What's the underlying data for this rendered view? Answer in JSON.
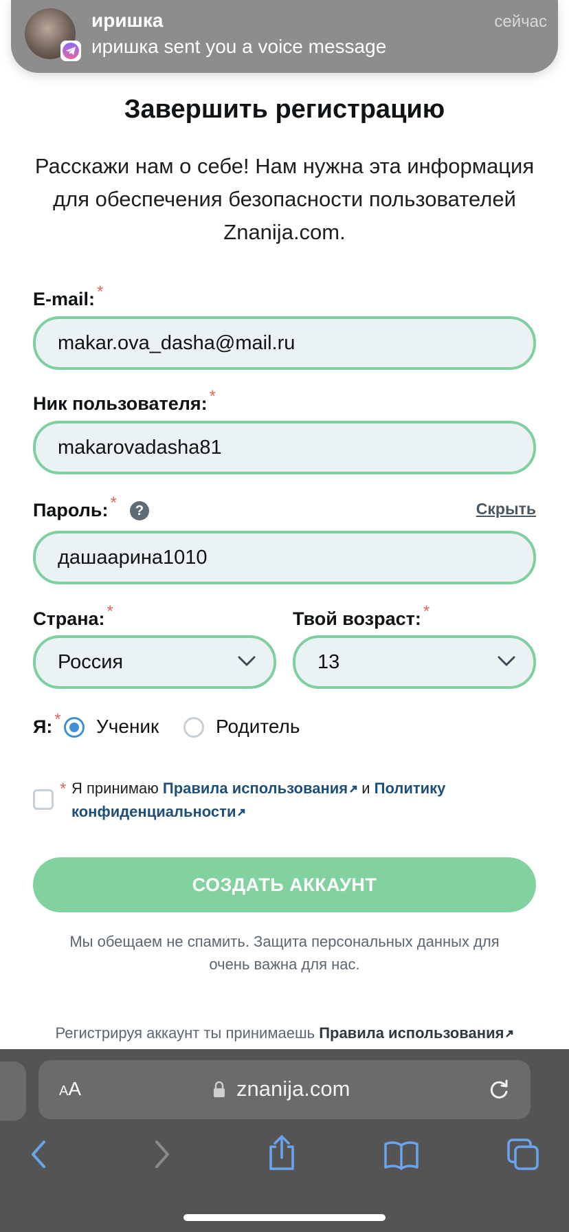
{
  "notification": {
    "sender": "иришка",
    "message": "иришка sent you a voice message",
    "time": "сейчас",
    "app_icon": "telegram-icon"
  },
  "form": {
    "title": "Завершить регистрацию",
    "subtitle": "Расскажи нам о себе! Нам нужна эта информация для обеспечения безопасности пользователей Znanija.com.",
    "required_mark": "*",
    "email": {
      "label": "E-mail:",
      "value": "makar.ova_dasha@mail.ru"
    },
    "nickname": {
      "label": "Ник пользователя:",
      "value": "makarovadasha81"
    },
    "password": {
      "label": "Пароль:",
      "value": "дашаарина1010",
      "help": "?",
      "toggle_label": "Скрыть"
    },
    "country": {
      "label": "Страна:",
      "value": "Россия"
    },
    "age": {
      "label": "Твой возраст:",
      "value": "13"
    },
    "role": {
      "label": "Я:",
      "options": [
        {
          "label": "Ученик",
          "selected": true
        },
        {
          "label": "Родитель",
          "selected": false
        }
      ]
    },
    "terms": {
      "checked": false,
      "prefix": "Я принимаю",
      "rules_link": "Правила использования",
      "and": "и",
      "policy_link": "Политику конфиденциальности"
    },
    "submit_label": "СОЗДАТЬ АККАУНТ",
    "promise": "Мы обещаем не спамить. Защита персональных данных для очень важна для нас.",
    "footer_prefix": "Регистрируя аккаунт ты принимаешь",
    "footer_link": "Правила использования"
  },
  "browser": {
    "text_size_label_small": "A",
    "text_size_label_large": "A",
    "url": "znanija.com"
  },
  "colors": {
    "accent_green": "#82d2a0",
    "field_border": "#7fcfa0",
    "field_bg": "#ebf2f4",
    "link_blue": "#1e4f7a",
    "radio_blue": "#3e8fd8",
    "required_red": "#e06b5a"
  }
}
